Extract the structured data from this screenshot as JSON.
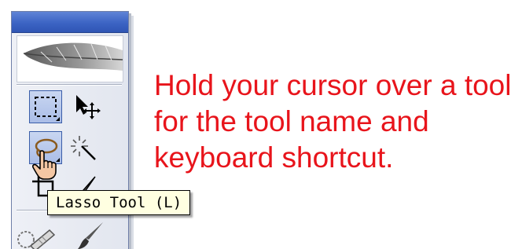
{
  "toolbox": {
    "logo_icon": "feather-icon",
    "tools": [
      {
        "name": "rectangular-marquee-tool",
        "icon": "marquee-icon",
        "selected": true
      },
      {
        "name": "move-tool",
        "icon": "move-icon",
        "selected": false
      },
      {
        "name": "lasso-tool",
        "icon": "lasso-icon",
        "selected": true
      },
      {
        "name": "magic-wand-tool",
        "icon": "magic-wand-icon",
        "selected": false
      },
      {
        "name": "crop-tool",
        "icon": "crop-icon",
        "selected": false
      },
      {
        "name": "slice-tool",
        "icon": "slice-icon",
        "selected": false
      },
      {
        "name": "healing-brush-tool",
        "icon": "healing-brush-icon",
        "selected": false
      },
      {
        "name": "brush-tool",
        "icon": "brush-icon",
        "selected": false
      }
    ]
  },
  "tooltip": {
    "text": "Lasso Tool (L)"
  },
  "instruction": {
    "line1": "Hold your cursor over a tool",
    "line2": "for the tool name and",
    "line3": "keyboard shortcut."
  },
  "colors": {
    "instruction_text": "#e8141b",
    "titlebar": "#3c64c4",
    "tooltip_bg": "#ffffe1",
    "selected_tool_bg": "#aabde7"
  }
}
